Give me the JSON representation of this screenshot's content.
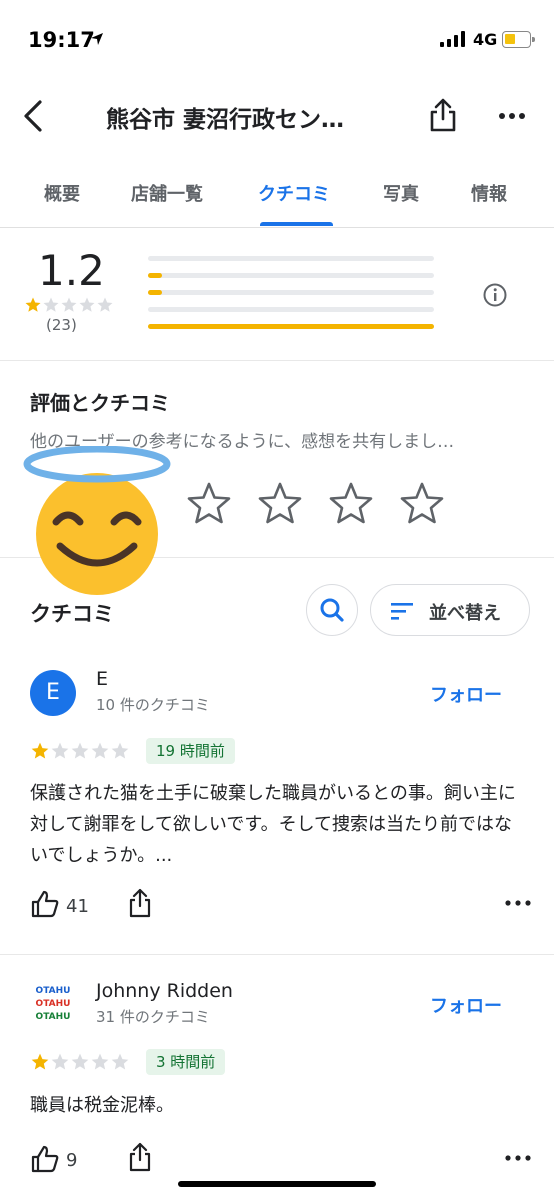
{
  "status": {
    "time": "19:17",
    "network": "4G"
  },
  "header": {
    "title": "熊谷市 妻沼行政セン…"
  },
  "tabs": [
    {
      "label": "概要"
    },
    {
      "label": "店舗一覧"
    },
    {
      "label": "クチコミ"
    },
    {
      "label": "写真"
    },
    {
      "label": "情報"
    }
  ],
  "summary": {
    "rating": "1.2",
    "count": "(23)",
    "stars_filled": 1,
    "distribution": [
      {
        "stars": 5,
        "fraction": 0.0
      },
      {
        "stars": 4,
        "fraction": 0.05
      },
      {
        "stars": 3,
        "fraction": 0.05
      },
      {
        "stars": 2,
        "fraction": 0.0
      },
      {
        "stars": 1,
        "fraction": 1.0
      }
    ]
  },
  "rate": {
    "title": "評価とクチコミ",
    "subtitle": "他のユーザーの参考になるように、感想を共有しまし…"
  },
  "reviews_section": {
    "title": "クチコミ",
    "sort_label": "並べ替え"
  },
  "reviews": [
    {
      "author": "E",
      "avatar_letter": "E",
      "review_count": "10 件のクチコミ",
      "follow_label": "フォロー",
      "stars_filled": 1,
      "time": "19 時間前",
      "text": "保護された猫を土手に破棄した職員がいるとの事。飼い主に対して謝罪をして欲しいです。そして捜索は当たり前ではないでしょうか。...",
      "likes": "41"
    },
    {
      "author": "Johnny Ridden",
      "review_count": "31 件のクチコミ",
      "follow_label": "フォロー",
      "stars_filled": 1,
      "time": "3 時間前",
      "text": "職員は税金泥棒。",
      "likes": "9",
      "avatar_logo_text": [
        "OTAHU",
        "OTAHU",
        "OTAHU"
      ]
    }
  ],
  "colors": {
    "accent": "#1a73e8",
    "star": "#f4b400",
    "badge_bg": "#e6f4ea",
    "badge_text": "#137333"
  }
}
